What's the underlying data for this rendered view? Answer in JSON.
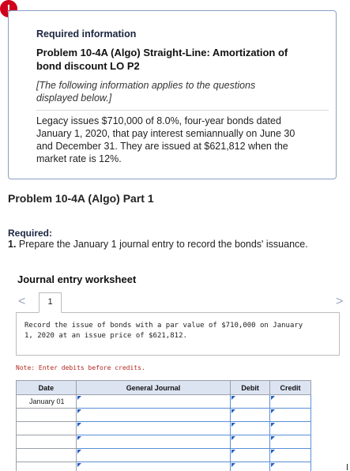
{
  "alert": {
    "symbol": "!",
    "icon": "alert-icon",
    "color": "#d0021b"
  },
  "info": {
    "required_information": "Required information",
    "problem_title": "Problem 10-4A (Algo) Straight-Line: Amortization of bond discount LO P2",
    "note": "[The following information applies to the questions displayed below.]",
    "legacy": "Legacy issues $710,000 of 8.0%, four-year bonds dated January 1, 2020, that pay interest semiannually on June 30 and December 31. They are issued at $621,812 when the market rate is 12%."
  },
  "part_title": "Problem 10-4A (Algo) Part 1",
  "required": {
    "label": "Required:",
    "item_number": "1.",
    "item_text": "Prepare the January 1 journal entry to record the bonds' issuance."
  },
  "worksheet": {
    "title": "Journal entry worksheet",
    "tab_label": "1",
    "nav_prev": "<",
    "nav_next": ">",
    "task": "Record the issue of bonds with a par value of $710,000 on January 1, 2020 at an issue price of $621,812.",
    "note": "Note: Enter debits before credits.",
    "columns": {
      "date": "Date",
      "general_journal": "General Journal",
      "debit": "Debit",
      "credit": "Credit"
    },
    "rows": [
      {
        "date": "January 01"
      },
      {
        "date": ""
      },
      {
        "date": ""
      },
      {
        "date": ""
      },
      {
        "date": ""
      },
      {
        "date": ""
      }
    ]
  },
  "colors": {
    "header_bg": "#dce4f2",
    "input_border": "#5a8fd6",
    "note_red": "#b3261e",
    "box_border": "#8aa0c8"
  }
}
